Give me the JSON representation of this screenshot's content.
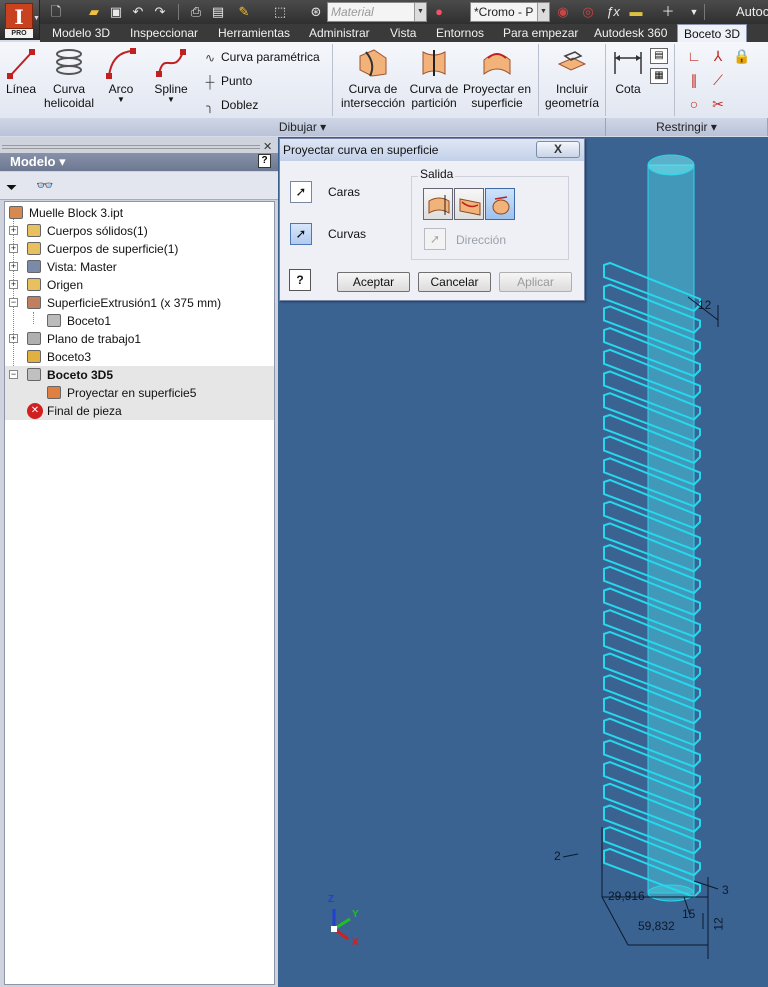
{
  "qat": {
    "material": "Material",
    "appearance": "*Cromo - P",
    "title_fragment": "Autoc",
    "pro_badge": "PRO",
    "logo_letter": "I"
  },
  "tabs": [
    "Modelo 3D",
    "Inspeccionar",
    "Herramientas",
    "Administrar",
    "Vista",
    "Entornos",
    "Para empezar",
    "Autodesk 360",
    "Boceto 3D"
  ],
  "ribbon": {
    "linea": "Línea",
    "curva_helicoidal_1": "Curva",
    "curva_helicoidal_2": "helicoidal",
    "arco": "Arco",
    "spline": "Spline",
    "curva_parametrica": "Curva paramétrica",
    "punto": "Punto",
    "doblez": "Doblez",
    "curva_interseccion_1": "Curva de",
    "curva_interseccion_2": "intersección",
    "curva_particion_1": "Curva de",
    "curva_particion_2": "partición",
    "proyectar_1": "Proyectar en",
    "proyectar_2": "superficie",
    "incluir_1": "Incluir",
    "incluir_2": "geometría",
    "cota": "Cota",
    "panel_dibujar": "Dibujar ▾",
    "panel_restringir": "Restringir ▾"
  },
  "browser": {
    "title": "Modelo ▾",
    "help": "?",
    "tree": [
      {
        "label": "Muelle Block 3.ipt",
        "indent": 0,
        "exp": "",
        "icon": "part"
      },
      {
        "label": "Cuerpos sólidos(1)",
        "indent": 1,
        "exp": "+",
        "icon": "folder-solid"
      },
      {
        "label": "Cuerpos de superficie(1)",
        "indent": 1,
        "exp": "+",
        "icon": "folder-surface"
      },
      {
        "label": "Vista: Master",
        "indent": 1,
        "exp": "+",
        "icon": "view"
      },
      {
        "label": "Origen",
        "indent": 1,
        "exp": "+",
        "icon": "folder"
      },
      {
        "label": "SuperficieExtrusión1 (x 375 mm)",
        "indent": 1,
        "exp": "−",
        "icon": "extrusion"
      },
      {
        "label": "Boceto1",
        "indent": 2,
        "exp": "",
        "icon": "sketch-gray"
      },
      {
        "label": "Plano de trabajo1",
        "indent": 1,
        "exp": "+",
        "icon": "plane"
      },
      {
        "label": "Boceto3",
        "indent": 1,
        "exp": "",
        "icon": "sketch"
      },
      {
        "label": "Boceto 3D5",
        "indent": 1,
        "exp": "−",
        "icon": "sketch3d"
      },
      {
        "label": "Proyectar en superficie5",
        "indent": 2,
        "exp": "",
        "icon": "project"
      },
      {
        "label": "Final de pieza",
        "indent": 1,
        "exp": "",
        "icon": "end"
      }
    ]
  },
  "dialog": {
    "title": "Proyectar curva en superficie",
    "close": "X",
    "caras": "Caras",
    "curvas": "Curvas",
    "salida": "Salida",
    "direccion": "Dirección",
    "help": "?",
    "aceptar": "Aceptar",
    "cancelar": "Cancelar",
    "aplicar": "Aplicar"
  },
  "viewport": {
    "dims": {
      "d12": "12",
      "d2": "2",
      "d3": "3",
      "d29": "29,916",
      "d15": "15",
      "d12b": "12",
      "d59": "59,832"
    },
    "axes": {
      "z": "Z",
      "y": "Y",
      "x": "X"
    }
  },
  "colors": {
    "viewport_bg": "#3b6391",
    "sketch_cyan": "#25d8ee",
    "surface_cyan": "#48e0ea"
  }
}
